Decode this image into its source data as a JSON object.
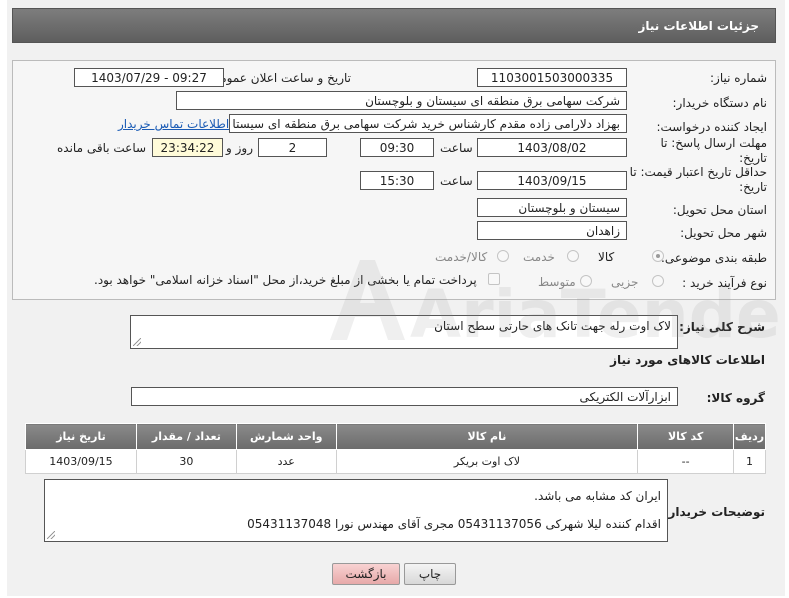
{
  "header": {
    "title": "جزئیات اطلاعات نیاز"
  },
  "form": {
    "need_number": {
      "label": "شماره نیاز:",
      "value": "1103001503000335"
    },
    "announce_datetime": {
      "label": "تاریخ و ساعت اعلان عمومی:",
      "value": "1403/07/29 - 09:27"
    },
    "buyer_org": {
      "label": "نام دستگاه خریدار:",
      "value": "شرکت سهامی برق منطقه ای سیستان و بلوچستان"
    },
    "requester": {
      "label": "ایجاد کننده درخواست:",
      "value": "بهزاد  دلارامی زاده مقدم کارشناس خرید شرکت سهامی برق منطقه ای سیستا",
      "contact_link": "اطلاعات تماس خریدار"
    },
    "reply_deadline": {
      "label": "مهلت ارسال پاسخ: تا تاریخ:",
      "date": "1403/08/02",
      "time_label": "ساعت",
      "time": "09:30",
      "days": "2",
      "days_label": "روز و",
      "remaining": "23:34:22",
      "remaining_label": "ساعت باقی مانده"
    },
    "price_validity": {
      "label": "حداقل تاریخ اعتبار قیمت: تا تاریخ:",
      "date": "1403/09/15",
      "time_label": "ساعت",
      "time": "15:30"
    },
    "province": {
      "label": "استان محل تحویل:",
      "value": "سیستان و بلوچستان"
    },
    "city": {
      "label": "شهر محل تحویل:",
      "value": "زاهدان"
    },
    "category": {
      "label": "طبقه بندی موضوعی:",
      "options": [
        "کالا",
        "خدمت",
        "کالا/خدمت"
      ],
      "selected": "کالا"
    },
    "purchase_type": {
      "label": "نوع فرآیند خرید :",
      "options": [
        "جزیی",
        "متوسط"
      ],
      "note": "پرداخت تمام یا بخشی از مبلغ خرید،از محل \"اسناد خزانه اسلامی\" خواهد بود."
    },
    "general_desc": {
      "label": "شرح کلی نیاز:",
      "value": "لاک اوت رله جهت تانک های حارتی سطح استان"
    }
  },
  "goods": {
    "section_title": "اطلاعات کالاهای مورد نیاز",
    "group_label": "گروه کالا:",
    "group_value": "ابزارآلات الکتریکی",
    "columns": [
      "ردیف",
      "کد کالا",
      "نام کالا",
      "واحد شمارش",
      "تعداد / مقدار",
      "تاریخ نیاز"
    ],
    "rows": [
      [
        "1",
        "--",
        "لاک اوت بریکر",
        "عدد",
        "30",
        "1403/09/15"
      ]
    ]
  },
  "buyer_notes": {
    "label": "توضیحات خریدار:",
    "line1": "ایران کد مشابه می باشد.",
    "line2": "اقدام کننده لیلا شهرکی 05431137056 مجری آقای مهندس نورا 05431137048"
  },
  "buttons": {
    "print": "چاپ",
    "back": "بازگشت"
  },
  "watermark": {
    "text": "AriaTender.net"
  }
}
